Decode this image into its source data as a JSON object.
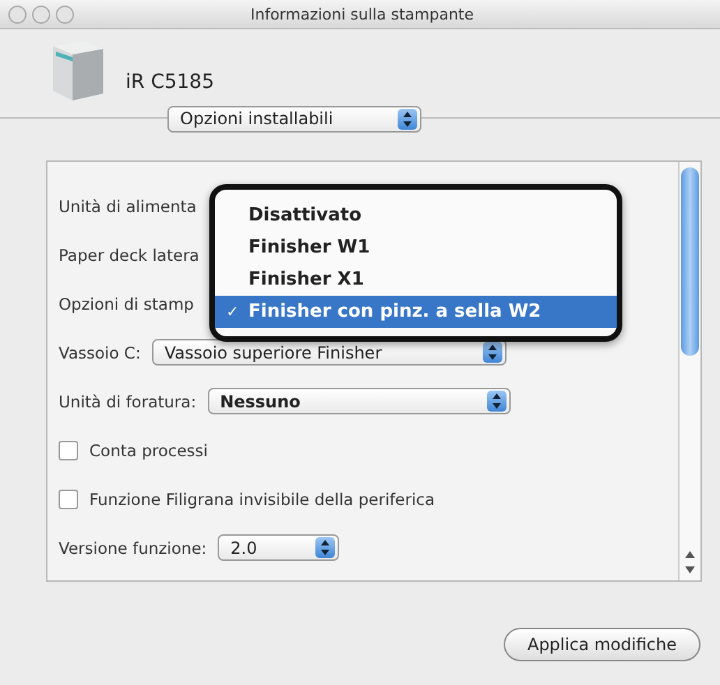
{
  "window": {
    "title": "Informazioni sulla stampante"
  },
  "printer": {
    "name": "iR C5185"
  },
  "section_popup": {
    "value": "Opzioni installabili"
  },
  "options": [
    {
      "kind": "label",
      "label": "Unità di alimenta"
    },
    {
      "kind": "label",
      "label": "Paper deck latera"
    },
    {
      "kind": "label",
      "label": "Opzioni di stamp"
    },
    {
      "kind": "popup",
      "label": "Vassoio C:",
      "value": "Vassoio superiore Finisher",
      "bold": false
    },
    {
      "kind": "popup",
      "label": "Unità di foratura:",
      "value": "Nessuno",
      "bold": true
    },
    {
      "kind": "checkbox",
      "label": "Conta processi",
      "checked": false
    },
    {
      "kind": "checkbox",
      "label": "Funzione Filigrana invisibile della periferica",
      "checked": false
    },
    {
      "kind": "popup",
      "label": "Versione funzione:",
      "value": "2.0",
      "bold": false
    }
  ],
  "menu": [
    {
      "label": "Disattivato",
      "selected": false
    },
    {
      "label": "Finisher W1",
      "selected": false
    },
    {
      "label": "Finisher X1",
      "selected": false
    },
    {
      "label": "Finisher con pinz. a sella W2",
      "selected": true,
      "mark": "✓"
    }
  ],
  "apply_button": {
    "label": "Applica modifiche"
  }
}
